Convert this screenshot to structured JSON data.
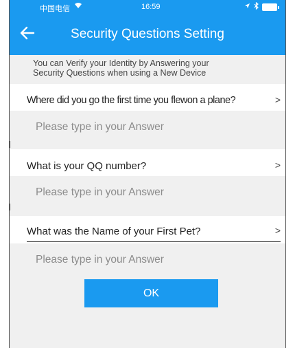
{
  "status_bar": {
    "carrier": "中国电信",
    "time": "16:59"
  },
  "nav": {
    "title": "Security Questions Setting"
  },
  "notice": {
    "line1": "You can Verify your Identity by Answering your",
    "line2": "Security Questions when using a New Device"
  },
  "questions": [
    {
      "text": "Where did you go the first time you flewon a plane?",
      "chevron": ">",
      "answer_placeholder": "Please type in your Answer"
    },
    {
      "text": "What is your QQ number?",
      "chevron": ">",
      "answer_placeholder": "Please type in your Answer"
    },
    {
      "text": "What was the Name of your First Pet?",
      "chevron": ">",
      "answer_placeholder": "Please type in your Answer"
    }
  ],
  "ok_label": "OK",
  "colors": {
    "accent": "#1a9af0",
    "background_gray": "#f0f0f0"
  }
}
